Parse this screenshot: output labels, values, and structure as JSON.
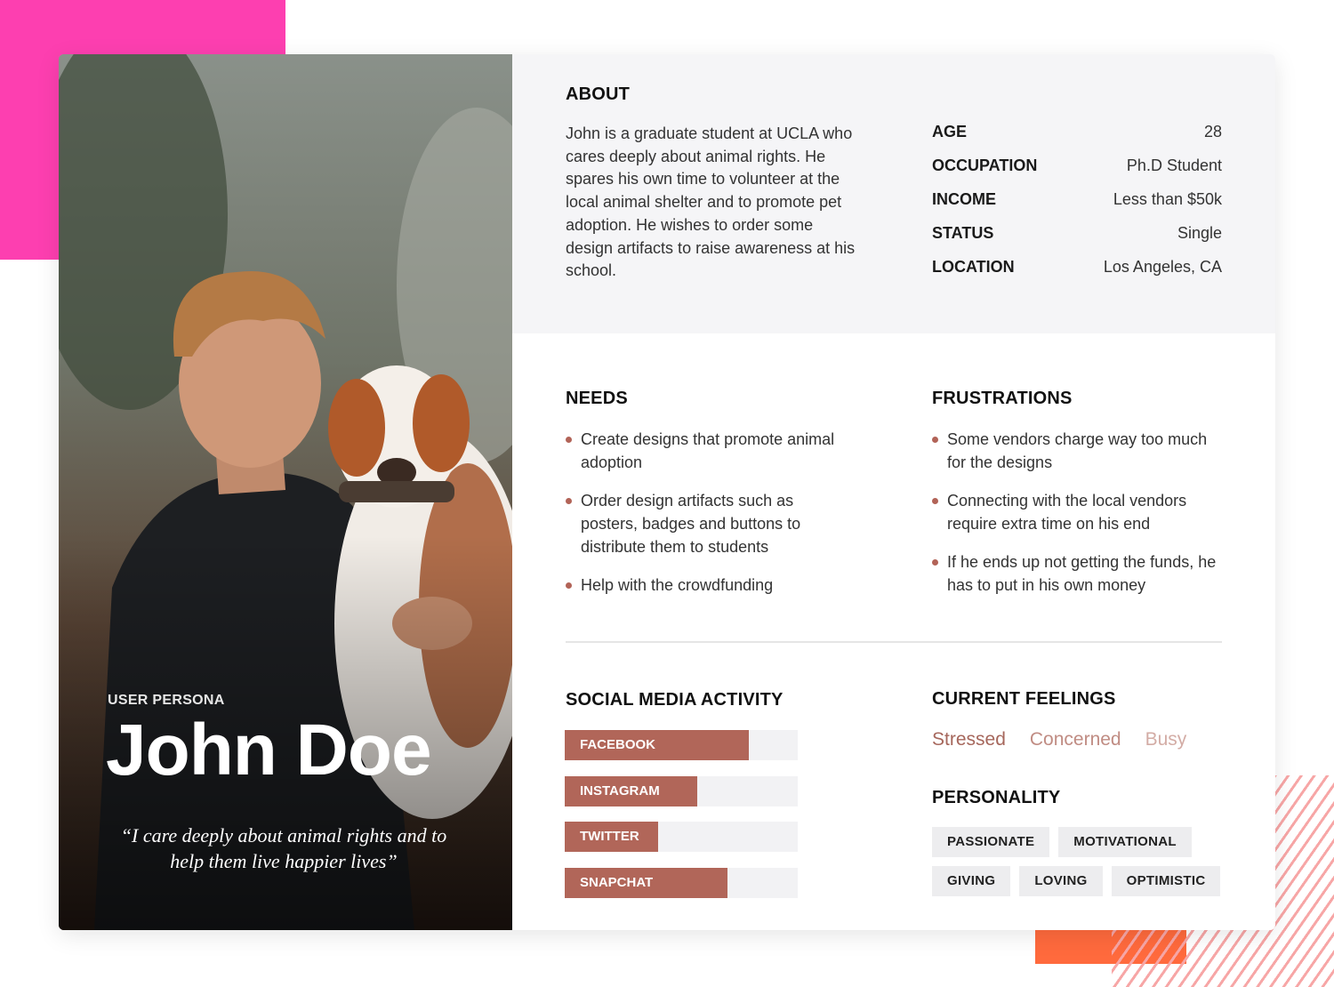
{
  "persona": {
    "label": "USER PERSONA",
    "name": "John Doe",
    "quote": "“I care deeply about animal rights and to help them live happier lives”"
  },
  "about": {
    "heading": "ABOUT",
    "text": "John is a graduate student at UCLA who cares deeply about animal rights. He spares his own time to volunteer at the local animal shelter and to promote pet adoption. He wishes to order some design artifacts to raise awareness at his school.",
    "facts": [
      {
        "label": "AGE",
        "value": "28"
      },
      {
        "label": "OCCUPATION",
        "value": "Ph.D Student"
      },
      {
        "label": "INCOME",
        "value": "Less than $50k"
      },
      {
        "label": "STATUS",
        "value": "Single"
      },
      {
        "label": "LOCATION",
        "value": "Los Angeles, CA"
      }
    ]
  },
  "needs": {
    "heading": "NEEDS",
    "items": [
      "Create designs that promote animal adoption",
      "Order design artifacts such as posters, badges and buttons to distribute them to students",
      "Help with the crowdfunding"
    ]
  },
  "frustrations": {
    "heading": "FRUSTRATIONS",
    "items": [
      "Some vendors charge way too much for the designs",
      "Connecting with the local vendors require extra time on his end",
      "If he ends up not getting the funds, he has to put in his own money"
    ]
  },
  "social": {
    "heading": "SOCIAL MEDIA ACTIVITY",
    "items": [
      {
        "label": "FACEBOOK",
        "level": 0.79
      },
      {
        "label": "INSTAGRAM",
        "level": 0.57
      },
      {
        "label": "TWITTER",
        "level": 0.4
      },
      {
        "label": "SNAPCHAT",
        "level": 0.7
      }
    ]
  },
  "feelings": {
    "heading": "CURRENT FEELINGS",
    "items": [
      "Stressed",
      "Concerned",
      "Busy"
    ]
  },
  "personality": {
    "heading": "PERSONALITY",
    "rows": [
      [
        "PASSIONATE",
        "MOTIVATIONAL"
      ],
      [
        "GIVING",
        "LOVING",
        "OPTIMISTIC"
      ]
    ]
  },
  "colors": {
    "accent": "#b16659",
    "pink": "#fd3fb0",
    "orange": "#ff6a3d"
  }
}
